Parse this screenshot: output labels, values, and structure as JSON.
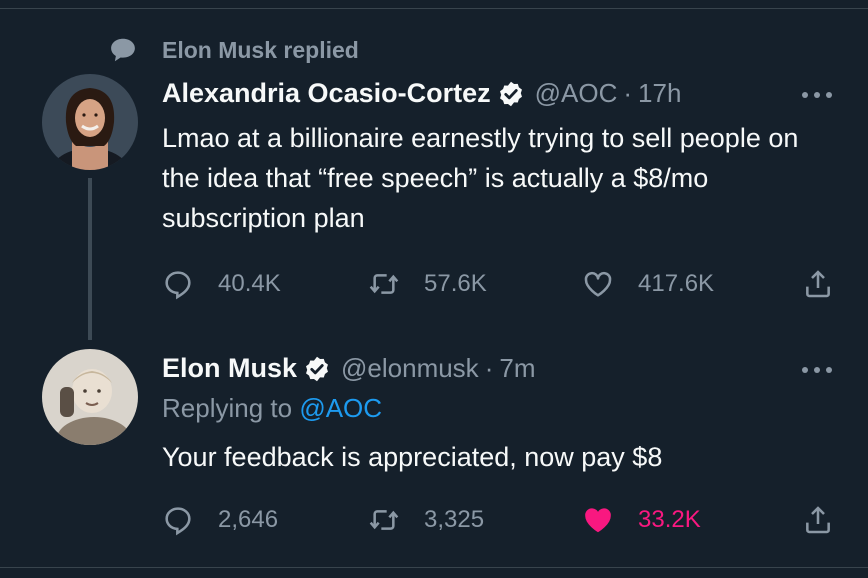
{
  "context": {
    "label": "Elon Musk replied",
    "icon": "speech-bubble-icon"
  },
  "tweets": [
    {
      "name": "Alexandria Ocasio-Cortez",
      "handle": "@AOC",
      "separator": "·",
      "time": "17h",
      "text": "Lmao at a billionaire earnestly trying to sell people on the idea that “free speech” is actually a $8/mo subscription plan",
      "replies": "40.4K",
      "retweets": "57.6K",
      "likes": "417.6K",
      "liked": false
    },
    {
      "name": "Elon Musk",
      "handle": "@elonmusk",
      "separator": "·",
      "time": "7m",
      "replying_prefix": "Replying to ",
      "replying_to": "@AOC",
      "text": "Your feedback is appreciated, now pay $8",
      "replies": "2,646",
      "retweets": "3,325",
      "likes": "33.2K",
      "liked": true
    }
  ],
  "colors": {
    "background": "#15202b",
    "text": "#f7f9f9",
    "muted": "#8b98a5",
    "link": "#1d9bf0",
    "like": "#f91880"
  }
}
